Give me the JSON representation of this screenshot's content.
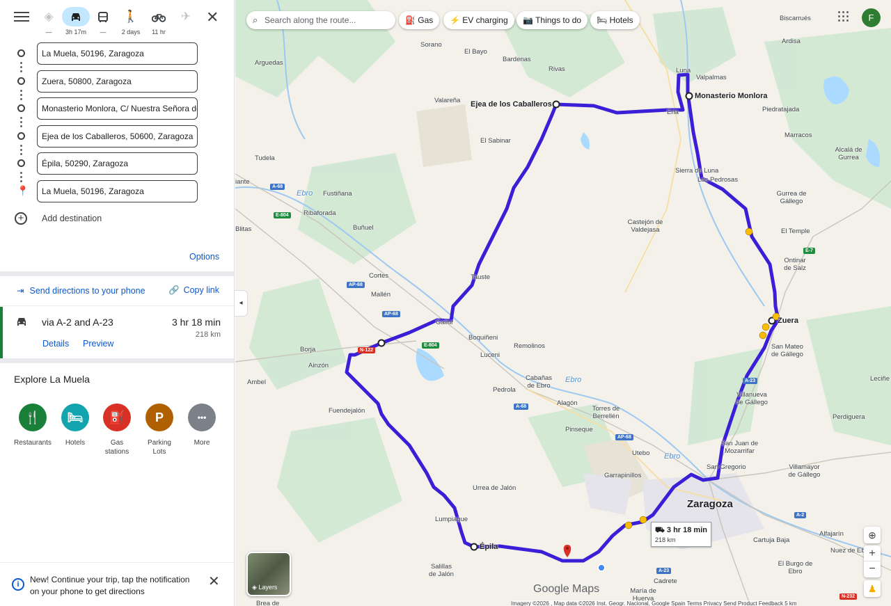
{
  "modes": [
    {
      "name": "best",
      "icon": "diamond-route-icon",
      "label": "—"
    },
    {
      "name": "driving",
      "icon": "car-icon",
      "label": "3h 17m"
    },
    {
      "name": "transit",
      "icon": "bus-icon",
      "label": "—"
    },
    {
      "name": "walking",
      "icon": "walk-icon",
      "label": "2 days"
    },
    {
      "name": "cycling",
      "icon": "bike-icon",
      "label": "11 hr"
    },
    {
      "name": "flight",
      "icon": "plane-icon",
      "label": ""
    }
  ],
  "stops": [
    "La Muela, 50196, Zaragoza",
    "Zuera, 50800, Zaragoza",
    "Monasterio Monlora, C/ Nuestra Señora de Monlora",
    "Ejea de los Caballeros, 50600, Zaragoza",
    "Épila, 50290, Zaragoza",
    "La Muela, 50196, Zaragoza"
  ],
  "add_destination": "Add destination",
  "options": "Options",
  "send_directions": "Send directions to your phone",
  "copy_link": "Copy link",
  "route": {
    "via": "via A-2 and A-23",
    "time": "3 hr 18 min",
    "distance": "218 km",
    "details": "Details",
    "preview": "Preview"
  },
  "explore": {
    "title": "Explore La Muela",
    "categories": [
      {
        "label": "Restaurants",
        "icon": "fork-knife-icon",
        "glyph": "🍴",
        "color": "#188038"
      },
      {
        "label": "Hotels",
        "icon": "bed-icon",
        "glyph": "🛏",
        "color": "#12a4af"
      },
      {
        "label": "Gas stations",
        "icon": "gas-pump-icon",
        "glyph": "⛽",
        "color": "#d93025"
      },
      {
        "label": "Parking Lots",
        "icon": "parking-icon",
        "glyph": "P",
        "color": "#b06000"
      },
      {
        "label": "More",
        "icon": "more-dots-icon",
        "glyph": "•••",
        "color": "#7b8089"
      }
    ]
  },
  "notice": "New! Continue your trip, tap the notification on your phone to get directions",
  "map": {
    "search_placeholder": "Search along the route...",
    "chips": [
      "Gas",
      "EV charging",
      "Things to do",
      "Hotels"
    ],
    "avatar": "F",
    "infobox_time": "3 hr 18 min",
    "infobox_distance": "218 km",
    "layers": "Layers",
    "google": "Google Maps",
    "attribution": "Imagery ©2026 , Map data ©2026 Inst. Geogr. Nacional, Google   Spain   Terms   Privacy   Send Product Feedback   5 km",
    "route_color": "#3b1fd6",
    "labels": {
      "towns_bold": [
        "Ejea de los Caballeros",
        "Monasterio Monlora",
        "Zuera",
        "Épila"
      ],
      "city": "Zaragoza",
      "towns": [
        "Sorano",
        "El Bayo",
        "Bardenas",
        "Rivas",
        "Luna",
        "Valpalmas",
        "Biscarrués",
        "Ardisa",
        "Arguedas",
        "Valareña",
        "Erla",
        "Piedratajada",
        "Marracos",
        "El Sabinar",
        "Alcalá de Gurrea",
        "Tudela",
        "Sierra de Luna",
        "Las Pedrosas",
        "Fustiñana",
        "Gurrea de Gállego",
        "Ribaforada",
        "Castejón de Valdejasa",
        "Buñuel",
        "El Temple",
        "Ontinar de Salz",
        "Cortes",
        "Tauste",
        "Mallén",
        "Gallur",
        "Boquiñeni",
        "Remolinos",
        "Borja",
        "Luceni",
        "San Mateo de Gállego",
        "Ainzón",
        "Ambel",
        "Pedrola",
        "Cabañas de Ebro",
        "Alagón",
        "Villanueva de Gállego",
        "Leciñe",
        "Fuendejalón",
        "Torres de Berrellén",
        "Perdiguera",
        "Pinseque",
        "San Juan de Mozarrifar",
        "Utebo",
        "San Gregorio",
        "Villamayor de Gállego",
        "Garrapinillos",
        "Urrea de Jalón",
        "Lumpiaque",
        "Alfajarín",
        "Cartuja Baja",
        "Nuez de Ebro",
        "El Burgo de Ebro",
        "Salillas de Jalón",
        "Cadrete",
        "María de Huerva",
        "Brea de",
        "Blitas",
        "iante"
      ],
      "rivers": [
        "Ebro",
        "Ebro",
        "Ebro"
      ],
      "roads": [
        "A-68",
        "E-804",
        "AP-68",
        "AP-68",
        "N-122",
        "E-804",
        "A-68",
        "AP-68",
        "A-23",
        "E-7",
        "A-23",
        "A-2",
        "N-232"
      ]
    }
  }
}
